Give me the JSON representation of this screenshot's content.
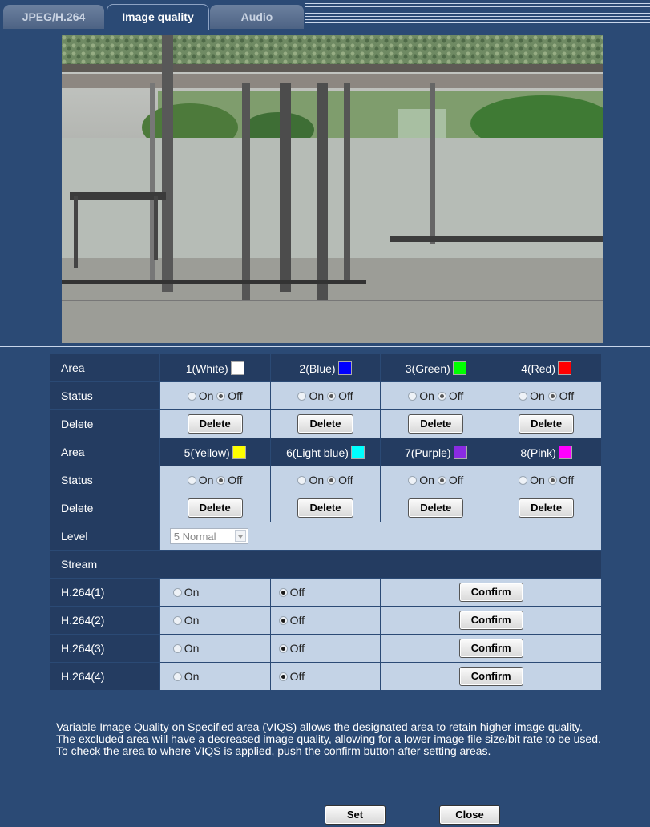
{
  "tabs": [
    {
      "label": "JPEG/H.264",
      "active": false
    },
    {
      "label": "Image quality",
      "active": true
    },
    {
      "label": "Audio",
      "active": false
    }
  ],
  "areas_row1": {
    "label": "Area",
    "items": [
      {
        "label": "1(White)",
        "color": "#ffffff"
      },
      {
        "label": "2(Blue)",
        "color": "#0000ff"
      },
      {
        "label": "3(Green)",
        "color": "#00ff00"
      },
      {
        "label": "4(Red)",
        "color": "#ff0000"
      }
    ]
  },
  "areas_row2": {
    "label": "Area",
    "items": [
      {
        "label": "5(Yellow)",
        "color": "#ffff00"
      },
      {
        "label": "6(Light blue)",
        "color": "#00ffff"
      },
      {
        "label": "7(Purple)",
        "color": "#8a2be2"
      },
      {
        "label": "8(Pink)",
        "color": "#ff00ff"
      }
    ]
  },
  "status": {
    "label": "Status",
    "on": "On",
    "off": "Off",
    "selected": "Off"
  },
  "delete": {
    "label": "Delete",
    "button": "Delete"
  },
  "level": {
    "label": "Level",
    "value": "5 Normal"
  },
  "stream": {
    "heading": "Stream",
    "on": "On",
    "off": "Off",
    "confirm": "Confirm",
    "rows": [
      {
        "label": "H.264(1)",
        "selected": "Off"
      },
      {
        "label": "H.264(2)",
        "selected": "Off"
      },
      {
        "label": "H.264(3)",
        "selected": "Off"
      },
      {
        "label": "H.264(4)",
        "selected": "Off"
      }
    ]
  },
  "note": {
    "line1": "Variable Image Quality on Specified area (VIQS) allows the designated area to retain higher image quality.",
    "line2": "The excluded area will have a decreased image quality, allowing for a lower image file size/bit rate to be used.",
    "line3": "To check the area to where VIQS is applied, push the confirm button after setting areas."
  },
  "footer": {
    "set": "Set",
    "close": "Close"
  }
}
